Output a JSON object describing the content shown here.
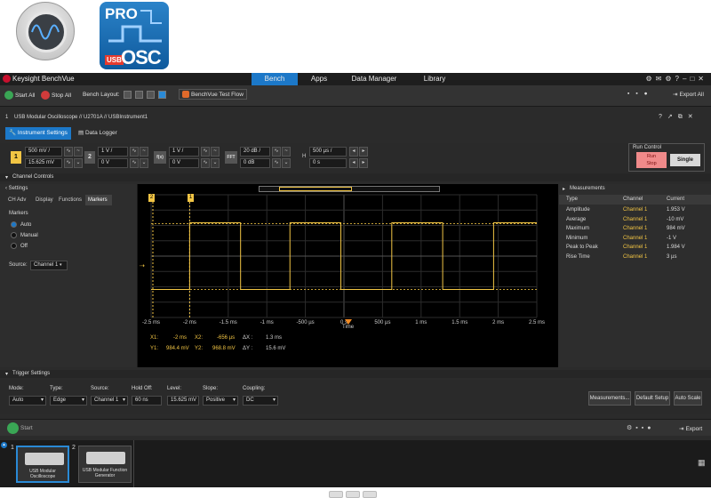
{
  "logos": {
    "pro_text": "PRO",
    "osc_text": "OSC",
    "usb_text": "USB"
  },
  "app": {
    "title": "Keysight BenchVue"
  },
  "nav": {
    "tabs": [
      "Bench",
      "Apps",
      "Data Manager",
      "Library"
    ],
    "active": "Bench"
  },
  "toolbar": {
    "start_all": "Start All",
    "stop_all": "Stop All",
    "bench_layout": "Bench Layout:",
    "test_flow": "BenchVue Test Flow",
    "export_all": "Export All"
  },
  "breadcrumb": {
    "index": "1",
    "path": "USB Modular Oscilloscope // U2701A // USBInstrument1"
  },
  "inst_tabs": {
    "settings": "Instrument Settings",
    "logger": "Data Logger"
  },
  "channels": {
    "ch1": {
      "label": "1",
      "scale": "500 mV /",
      "offset": "15.625 mV",
      "color": "#f2c544"
    },
    "ch2": {
      "label": "2",
      "scale": "1 V /",
      "offset": "0 V"
    },
    "math": {
      "label": "f(x)",
      "scale": "1 V /",
      "offset": "0 V"
    },
    "fft": {
      "label": "FFT",
      "scale": "20 dB /",
      "offset": "0 dB"
    },
    "timebase": {
      "label": "H",
      "scale": "500 µs /",
      "offset": "0 s"
    }
  },
  "run_control": {
    "title": "Run Control",
    "run_stop": "Run\nStop",
    "single": "Single"
  },
  "channel_controls": {
    "label": "Channel Controls"
  },
  "settings_panel": {
    "title": "Settings",
    "tabs": [
      "CH Adv",
      "Display",
      "Functions",
      "Markers"
    ],
    "active_tab": "Markers",
    "section": "Markers",
    "options": [
      "Auto",
      "Manual",
      "Off"
    ],
    "selected": "Auto",
    "source_label": "Source:",
    "source_value": "Channel 1"
  },
  "scope": {
    "x_ticks": [
      "-2.5 ms",
      "-2 ms",
      "-1.5 ms",
      "-1 ms",
      "-500 µs",
      "0 s",
      "500 µs",
      "1 ms",
      "1.5 ms",
      "2 ms",
      "2.5 ms"
    ],
    "x_label": "Time",
    "marker_x1_label": "1",
    "marker_x2_label": "2",
    "readout": {
      "x1_label": "X1:",
      "x1_value": "-2 ms",
      "x2_label": "X2:",
      "x2_value": "-656 µs",
      "dx_label": "ΔX :",
      "dx_value": "1.3 ms",
      "y1_label": "Y1:",
      "y1_value": "984.4 mV",
      "y2_label": "Y2:",
      "y2_value": "968.8 mV",
      "dy_label": "ΔY :",
      "dy_value": "15.6 mV"
    }
  },
  "measurements": {
    "title": "Measurements",
    "headers": [
      "Type",
      "Channel",
      "Current"
    ],
    "rows": [
      [
        "Amplitude",
        "Channel 1",
        "1.953 V"
      ],
      [
        "Average",
        "Channel 1",
        "-10 mV"
      ],
      [
        "Maximum",
        "Channel 1",
        "984 mV"
      ],
      [
        "Minimum",
        "Channel 1",
        "-1 V"
      ],
      [
        "Peak to Peak",
        "Channel 1",
        "1.984 V"
      ],
      [
        "Rise Time",
        "Channel 1",
        "3 µs"
      ]
    ]
  },
  "trigger": {
    "title": "Trigger Settings",
    "mode_label": "Mode:",
    "mode": "Auto",
    "type_label": "Type:",
    "type": "Edge",
    "source_label": "Source:",
    "source": "Channel 1",
    "holdoff_label": "Hold Off:",
    "holdoff": "60 ns",
    "level_label": "Level:",
    "level": "15.625 mV",
    "slope_label": "Slope:",
    "slope": "Positive",
    "coupling_label": "Coupling:",
    "coupling": "DC",
    "measurements_btn": "Measurements...",
    "default_setup_btn": "Default Setup",
    "auto_scale_btn": "Auto Scale"
  },
  "bottom": {
    "start": "Start",
    "export": "Export"
  },
  "instruments": [
    {
      "num": "1",
      "caption": "USB Modular Oscilloscope"
    },
    {
      "num": "2",
      "caption": "USB Modular Function Generator"
    }
  ],
  "colors": {
    "accent": "#1c78c8",
    "trace": "#f2c544",
    "run_stop_bg": "#f08a8a"
  }
}
